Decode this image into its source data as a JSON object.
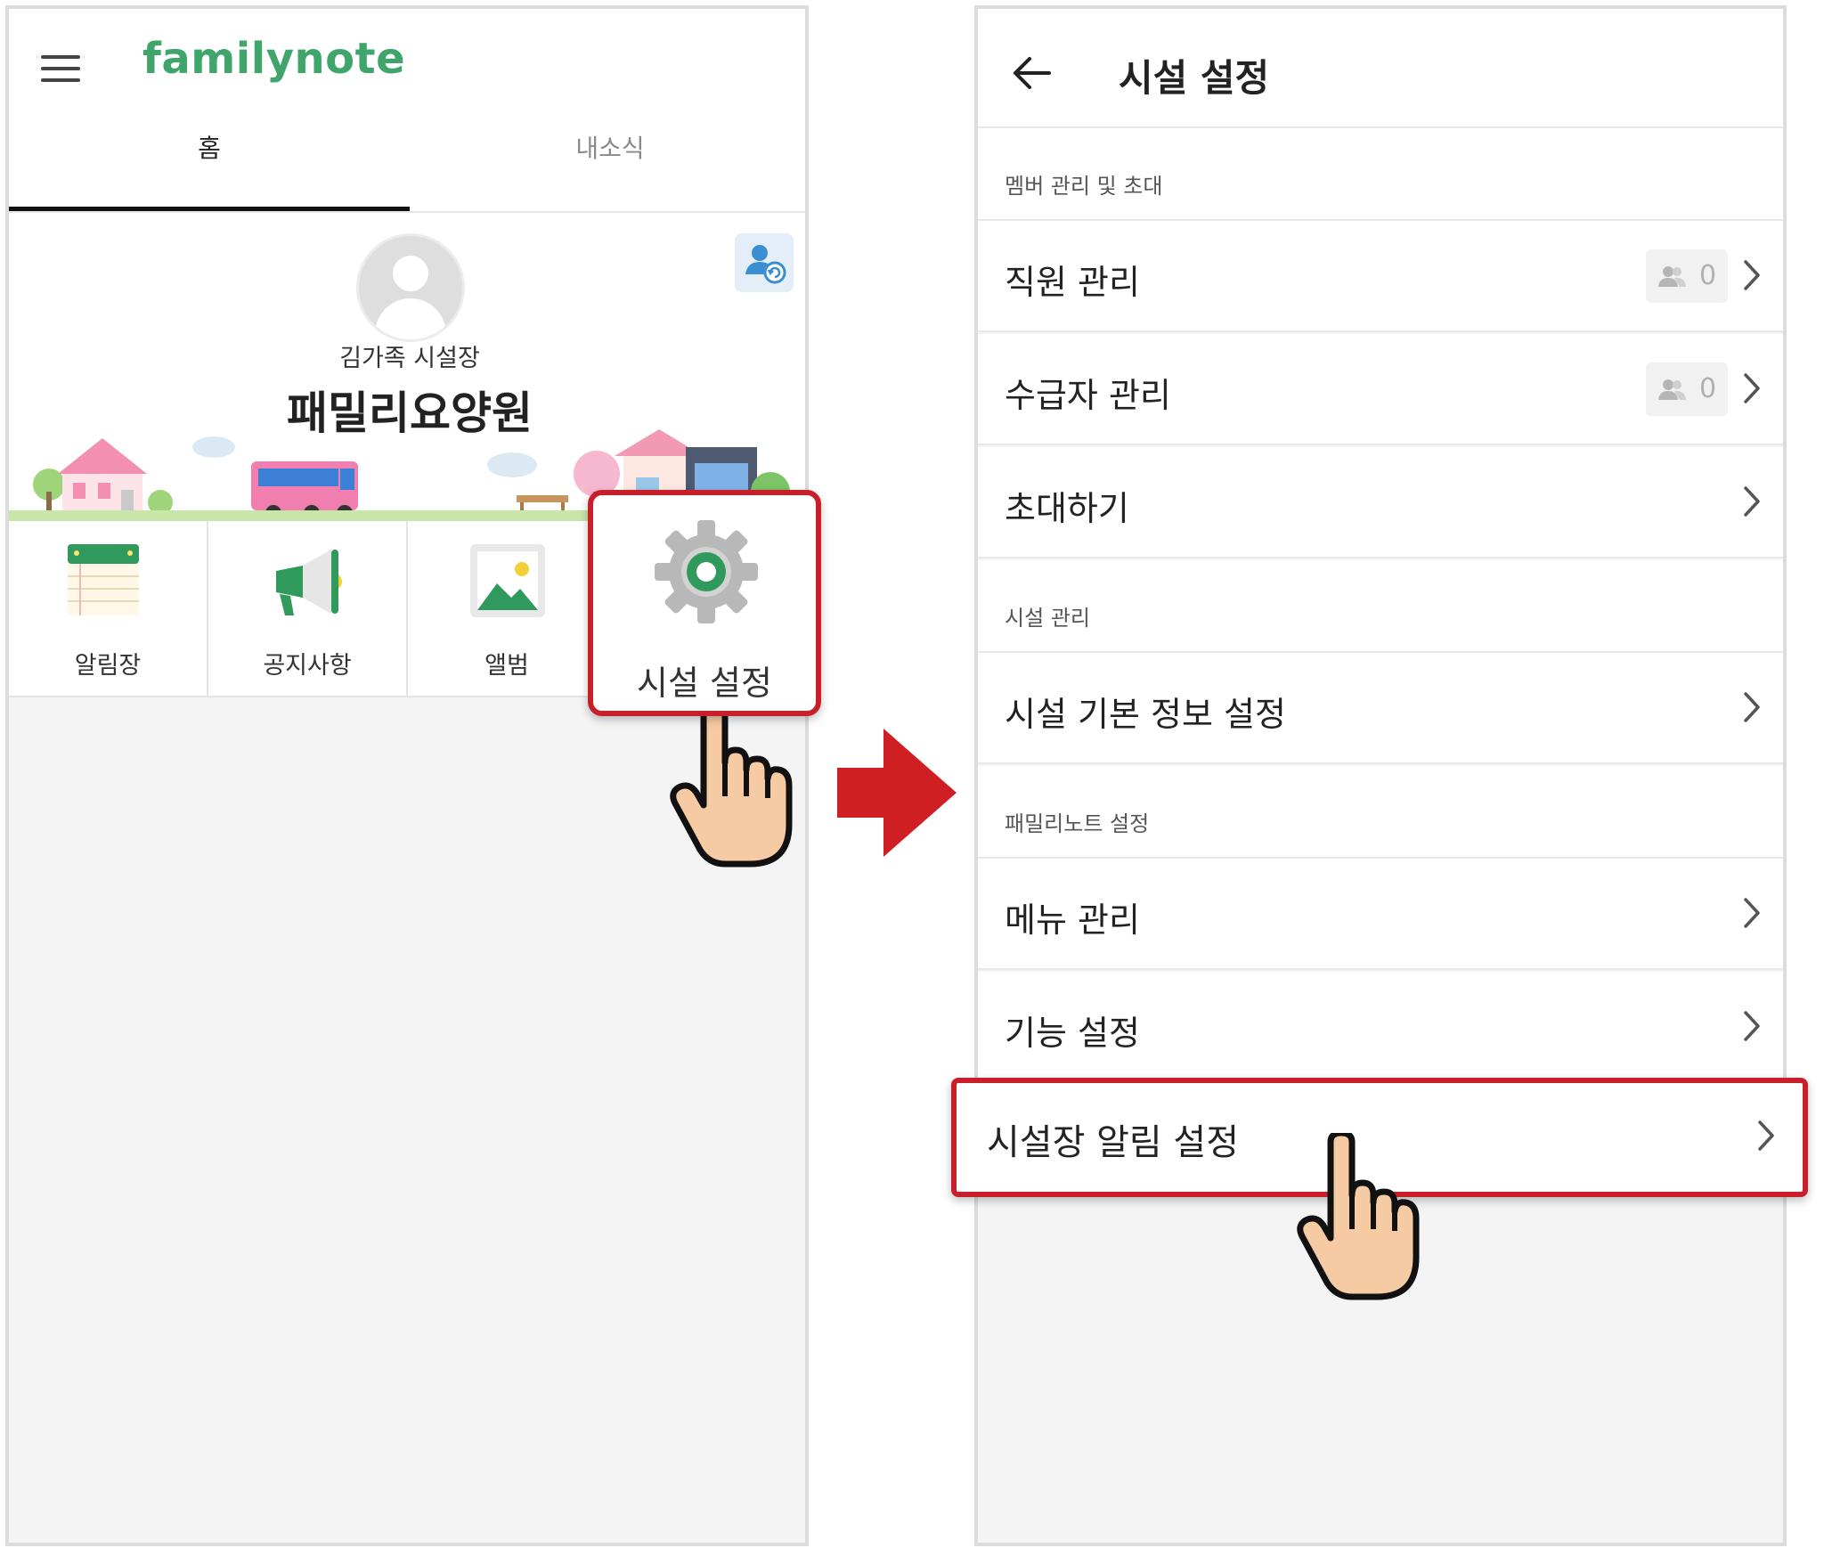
{
  "left_screen": {
    "logo": "familynote",
    "tabs": [
      "홈",
      "내소식"
    ],
    "director_name": "김가족 시설장",
    "facility_name": "패밀리요양원",
    "menu_icons": [
      {
        "label": "알림장",
        "icon": "notebook-icon"
      },
      {
        "label": "공지사항",
        "icon": "megaphone-icon"
      },
      {
        "label": "앨범",
        "icon": "photo-album-icon"
      },
      {
        "label": "시설 설정",
        "icon": "gear-icon"
      }
    ]
  },
  "right_screen": {
    "title": "시설 설정",
    "sections": [
      {
        "header": "멤버 관리 및 초대",
        "items": [
          {
            "label": "직원 관리",
            "count": "0"
          },
          {
            "label": "수급자 관리",
            "count": "0"
          },
          {
            "label": "초대하기"
          }
        ]
      },
      {
        "header": "시설 관리",
        "items": [
          {
            "label": "시설 기본 정보 설정"
          }
        ]
      },
      {
        "header": "패밀리노트 설정",
        "items": [
          {
            "label": "메뉴 관리"
          },
          {
            "label": "기능 설정"
          },
          {
            "label": "시설장 알림 설정"
          }
        ]
      }
    ]
  },
  "colors": {
    "brand_green": "#3fa56b",
    "highlight_red": "#c8202b",
    "arrow_red": "#d01f23",
    "hand_skin": "#f6cba3"
  }
}
